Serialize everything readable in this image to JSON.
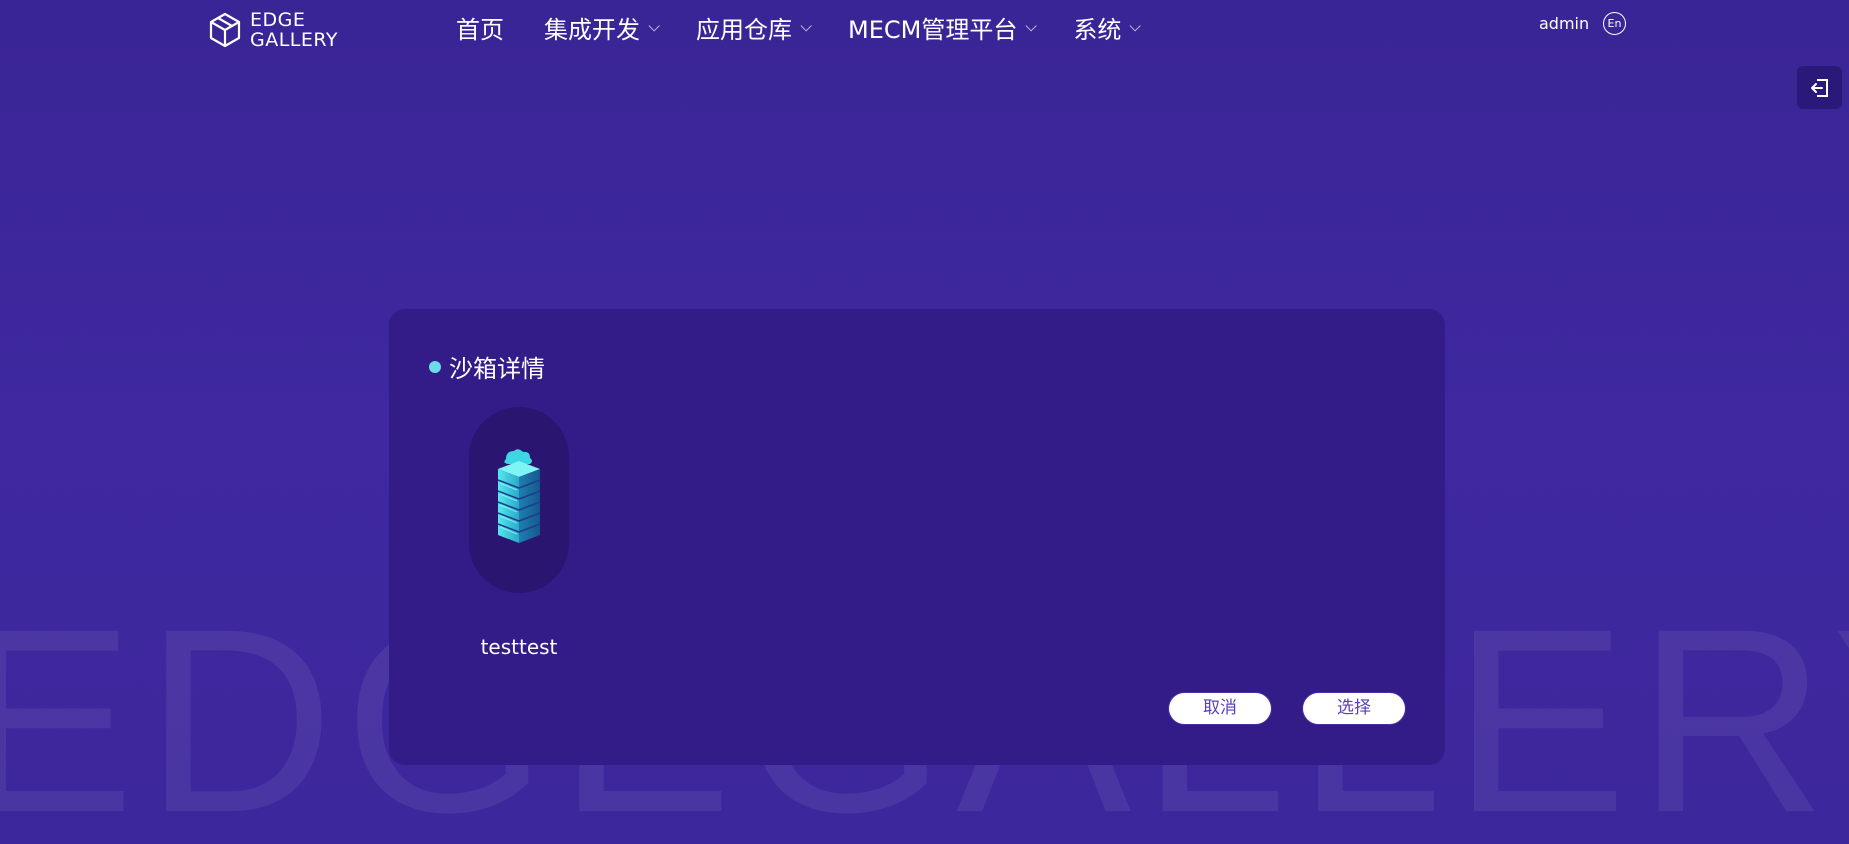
{
  "watermark": "EDGEGALLERY",
  "header": {
    "logo_line1": "EDGE",
    "logo_line2": "GALLERY",
    "nav": [
      {
        "label": "首页",
        "has_dropdown": false
      },
      {
        "label": "集成开发",
        "has_dropdown": true
      },
      {
        "label": "应用仓库",
        "has_dropdown": true
      },
      {
        "label": "MECM管理平台",
        "has_dropdown": true
      },
      {
        "label": "系统",
        "has_dropdown": true
      }
    ],
    "user": "admin",
    "lang": "En"
  },
  "panel": {
    "title": "沙箱详情",
    "sandbox_name": "testtest",
    "cancel_label": "取消",
    "select_label": "选择"
  },
  "colors": {
    "background": "#3e279e",
    "panel": "#331b88",
    "accent_dot": "#6ddbe9",
    "button_text": "#5a3fb8"
  }
}
